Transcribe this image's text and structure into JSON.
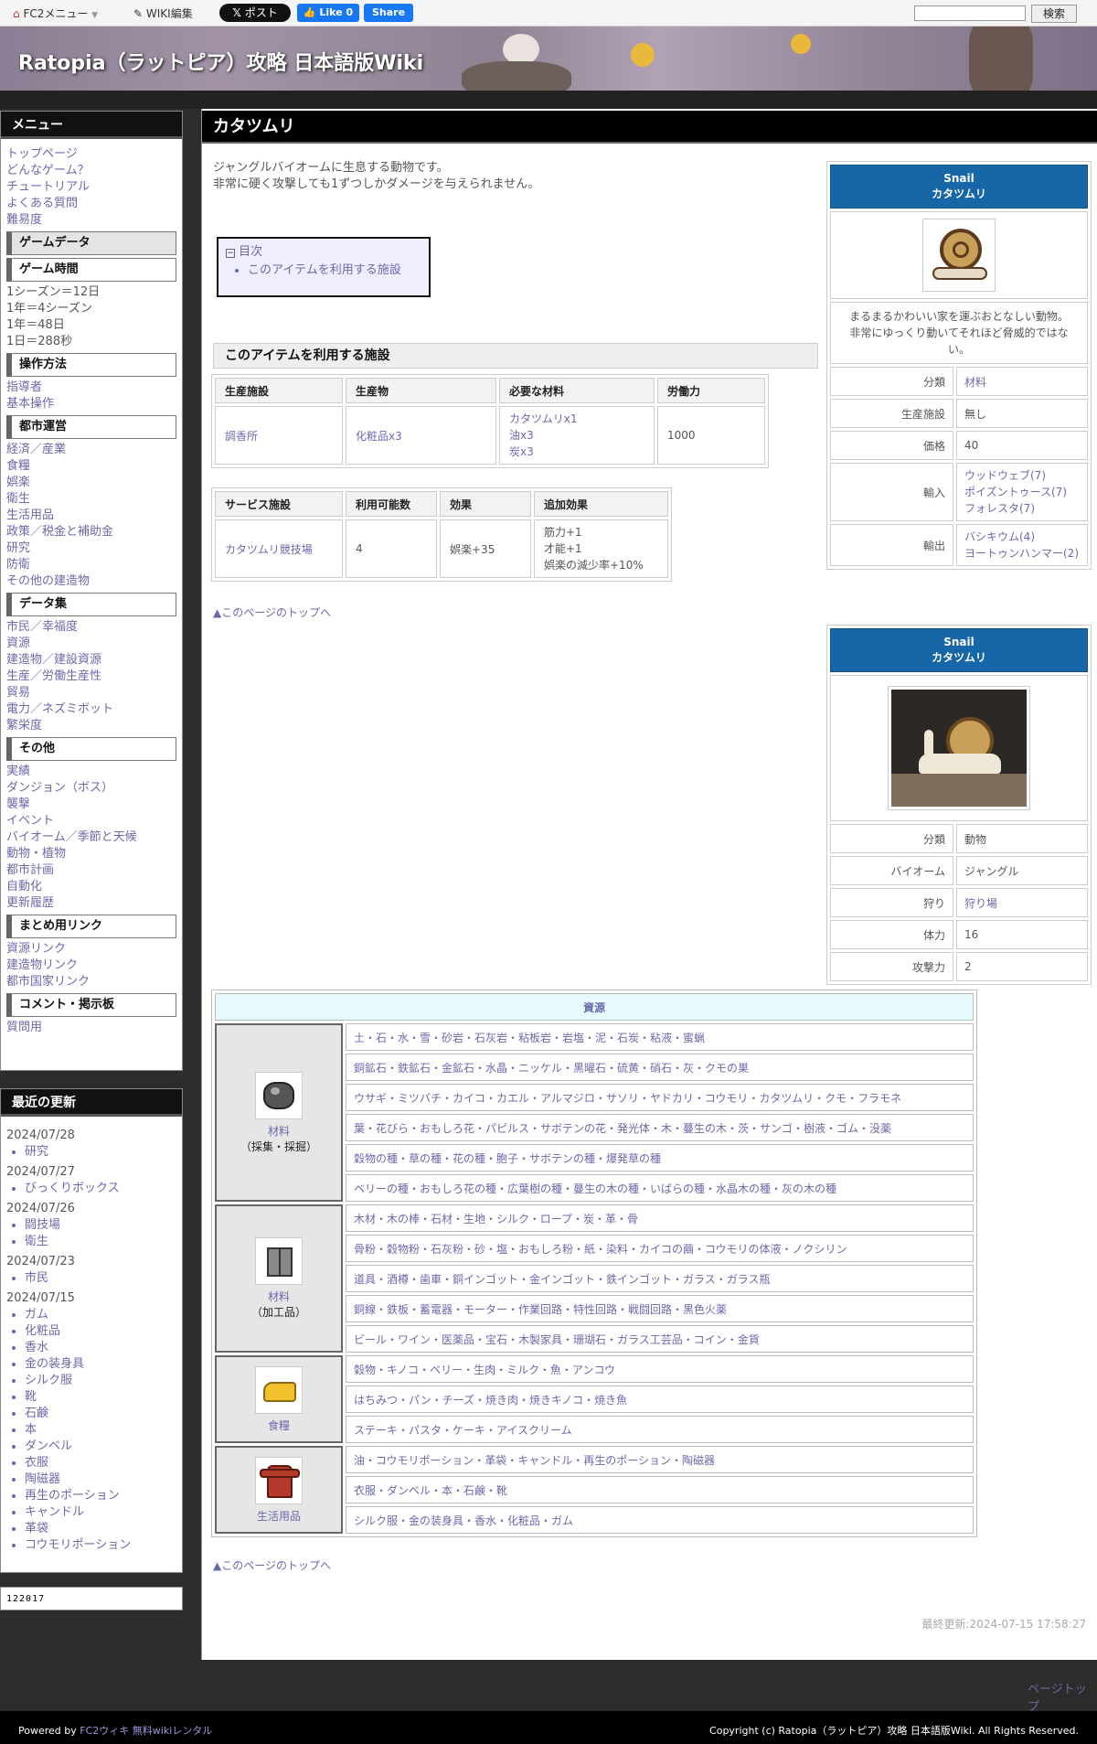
{
  "topbar": {
    "fc2_menu": "FC2メニュー",
    "wiki_edit": "WIKI編集",
    "x_post": "ポスト",
    "fb_like": "Like 0",
    "fb_share": "Share",
    "search_button": "検索"
  },
  "site_title": "Ratopia（ラットピア）攻略 日本語版Wiki",
  "menu": {
    "title": "メニュー",
    "items": [
      "トップページ",
      "どんなゲーム？",
      "チュートリアル",
      "よくある質問",
      "難易度"
    ],
    "game_data": "ゲームデータ",
    "game_time": "ゲーム時間",
    "time_items": [
      "1シーズン＝12日",
      "1年＝4シーズン",
      "1年＝48日",
      "1日＝288秒"
    ],
    "controls": "操作方法",
    "controls_items": [
      "指導者",
      "基本操作"
    ],
    "city": "都市運営",
    "city_items": [
      "経済／産業",
      "食糧",
      "娯楽",
      "衛生",
      "生活用品",
      "政策／税金と補助金",
      "研究",
      "防衛",
      "その他の建造物"
    ],
    "datasets": "データ集",
    "datasets_items": [
      "市民／幸福度",
      "資源",
      "建造物／建設資源",
      "生産／労働生産性",
      "貿易",
      "電力／ネズミボット",
      "繁栄度"
    ],
    "other": "その他",
    "other_items": [
      "実績",
      "ダンジョン（ボス）",
      "襲撃",
      "イベント",
      "バイオーム／季節と天候",
      "動物・植物",
      "都市計画",
      "自動化",
      "更新履歴"
    ],
    "links": "まとめ用リンク",
    "links_items": [
      "資源リンク",
      "建造物リンク",
      "都市国家リンク"
    ],
    "comment": "コメント・掲示板",
    "comment_items": [
      "質問用"
    ]
  },
  "updates": {
    "title": "最近の更新",
    "groups": [
      {
        "date": "2024/07/28",
        "items": [
          "研究"
        ]
      },
      {
        "date": "2024/07/27",
        "items": [
          "びっくりボックス"
        ]
      },
      {
        "date": "2024/07/26",
        "items": [
          "闘技場",
          "衛生"
        ]
      },
      {
        "date": "2024/07/23",
        "items": [
          "市民"
        ]
      },
      {
        "date": "2024/07/15",
        "items": [
          "ガム",
          "化粧品",
          "香水",
          "金の装身具",
          "シルク服",
          "靴",
          "石鹸",
          "本",
          "ダンベル",
          "衣服",
          "陶磁器",
          "再生のポーション",
          "キャンドル",
          "革袋",
          "コウモリポーション"
        ]
      }
    ]
  },
  "counter": "122017",
  "page": {
    "title": "カタツムリ",
    "intro1": "ジャングルバイオームに生息する動物です。",
    "intro2": "非常に硬く攻撃しても1ずつしかダメージを与えられません。",
    "toc_title": "目次",
    "toc_item": "このアイテムを利用する施設",
    "section": "このアイテムを利用する施設",
    "prod_table": {
      "headers": [
        "生産施設",
        "生産物",
        "必要な材料",
        "労働力"
      ],
      "row": {
        "facility": "調香所",
        "product": "化粧品x3",
        "materials": [
          "カタツムリx1",
          "油x3",
          "炭x3"
        ],
        "labor": "1000"
      }
    },
    "service_table": {
      "headers": [
        "サービス施設",
        "利用可能数",
        "効果",
        "追加効果"
      ],
      "row": {
        "facility": "カタツムリ競技場",
        "count": "4",
        "effect": "娯楽+35",
        "extra": [
          "筋力+1",
          "才能+1",
          "娯楽の減少率+10%"
        ]
      }
    },
    "to_top": "▲このページのトップへ",
    "last_updated": "最終更新:2024-07-15 17:58:27"
  },
  "infobox1": {
    "name_en": "Snail",
    "name_jp": "カタツムリ",
    "desc": "まるまるかわいい家を運ぶおとなしい動物。非常にゆっくり動いてそれほど脅威的ではない。",
    "rows": [
      {
        "label": "分類",
        "value": "材料"
      },
      {
        "label": "生産施設",
        "value": "無し"
      },
      {
        "label": "価格",
        "value": "40"
      }
    ],
    "import_label": "輸入",
    "import_items": [
      "ウッドウェブ(7)",
      "ポイズントゥース(7)",
      "フォレスタ(7)"
    ],
    "export_label": "輸出",
    "export_items": [
      "バシキウム(4)",
      "ヨートゥンハンマー(2)"
    ]
  },
  "infobox2": {
    "name_en": "Snail",
    "name_jp": "カタツムリ",
    "rows": [
      {
        "label": "分類",
        "value": "動物"
      },
      {
        "label": "バイオーム",
        "value": "ジャングル"
      },
      {
        "label": "狩り",
        "value": "狩り場"
      },
      {
        "label": "体力",
        "value": "16"
      },
      {
        "label": "攻撃力",
        "value": "2"
      }
    ]
  },
  "resources": {
    "title": "資源",
    "groups": [
      {
        "link": "材料",
        "sub": "（採集・採掘）",
        "icon": "ore-icon",
        "rows": [
          "土・石・水・雪・砂岩・石灰岩・粘板岩・岩塩・泥・石炭・粘液・蜜蝋",
          "銅鉱石・鉄鉱石・金鉱石・水晶・ニッケル・黒曜石・硫黄・硝石・灰・クモの巣",
          "ウサギ・ミツバチ・カイコ・カエル・アルマジロ・サソリ・ヤドカリ・コウモリ・カタツムリ・クモ・フラモネ",
          "葉・花びら・おもしろ花・パピルス・サボテンの花・発光体・木・蔓生の木・茨・サンゴ・樹液・ゴム・没薬",
          "穀物の種・草の種・花の種・胞子・サボテンの種・爆発草の種",
          "ベリーの種・おもしろ花の種・広葉樹の種・蔓生の木の種・いばらの種・水晶木の種・灰の木の種"
        ]
      },
      {
        "link": "材料",
        "sub": "（加工品）",
        "icon": "crate-icon",
        "rows": [
          "木材・木の棒・石材・生地・シルク・ロープ・炭・革・骨",
          "骨粉・穀物粉・石灰粉・砂・塩・おもしろ粉・紙・染料・カイコの繭・コウモリの体液・ノクシリン",
          "道具・酒樽・歯車・銅インゴット・金インゴット・鉄インゴット・ガラス・ガラス瓶",
          "銅線・鉄板・蓄電器・モーター・作業回路・特性回路・戦闘回路・黒色火薬",
          "ビール・ワイン・医薬品・宝石・木製家具・珊瑚石・ガラス工芸品・コイン・金貨"
        ]
      },
      {
        "link": "食糧",
        "sub": "",
        "icon": "cheese-icon",
        "rows": [
          "穀物・キノコ・ベリー・生肉・ミルク・魚・アンコウ",
          "はちみつ・パン・チーズ・焼き肉・焼きキノコ・焼き魚",
          "ステーキ・パスタ・ケーキ・アイスクリーム"
        ]
      },
      {
        "link": "生活用品",
        "sub": "",
        "icon": "clothes-icon",
        "rows": [
          "油・コウモリポーション・革袋・キャンドル・再生のポーション・陶磁器",
          "衣服・ダンベル・本・石鹸・靴",
          "シルク服・金の装身具・香水・化粧品・ガム"
        ]
      }
    ]
  },
  "page_top": "ページトップ",
  "footer": {
    "powered": "Powered by",
    "link1": "FC2ウィキ",
    "link2": "無料wikiレンタル",
    "copyright": "Copyright (c) Ratopia（ラットピア）攻略 日本語版Wiki. All Rights Reserved."
  }
}
